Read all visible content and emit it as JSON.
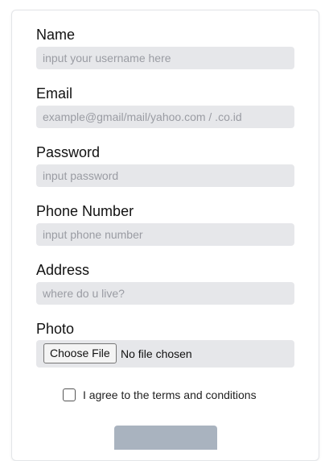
{
  "form": {
    "name": {
      "label": "Name",
      "placeholder": "input your username here"
    },
    "email": {
      "label": "Email",
      "placeholder": "example@gmail/mail/yahoo.com / .co.id"
    },
    "password": {
      "label": "Password",
      "placeholder": "input password"
    },
    "phone": {
      "label": "Phone Number",
      "placeholder": "input phone number"
    },
    "address": {
      "label": "Address",
      "placeholder": "where do u live?"
    },
    "photo": {
      "label": "Photo",
      "button_label": "Choose File",
      "status": "No file chosen"
    },
    "terms": {
      "label": "I agree to the terms and conditions",
      "checked": false
    },
    "submit": {
      "label": ""
    }
  },
  "colors": {
    "input_bg": "#e6e7ea",
    "placeholder": "#9a9ca3",
    "submit_bg": "#a9b3bf"
  }
}
